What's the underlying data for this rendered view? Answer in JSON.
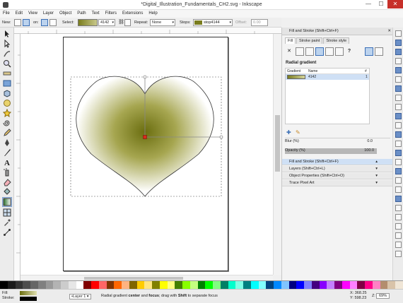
{
  "window": {
    "title": "*Digital_Illustration_Fundamentals_CH2.svg - Inkscape",
    "min": "—",
    "max": "☐",
    "close": "✕"
  },
  "menu": [
    "File",
    "Edit",
    "View",
    "Layer",
    "Object",
    "Path",
    "Text",
    "Filters",
    "Extensions",
    "Help"
  ],
  "toolctrl": {
    "new_label": "New:",
    "on_label": "on:",
    "select_label": "Select:",
    "gradient_name": "4142",
    "repeat_label": "Repeat:",
    "repeat_value": "None",
    "stops_label": "Stops:",
    "stop_value": "stop4144",
    "offset_label": "Offset:",
    "offset_value": "0.00"
  },
  "dock": {
    "header": "Fill and Stroke (Shift+Ctrl+F)",
    "tabs": [
      "Fill",
      "Stroke paint",
      "Stroke style"
    ],
    "paint_buttons": [
      "✕",
      "",
      "",
      "",
      "",
      "",
      "?"
    ],
    "gradient_type": "Radial gradient",
    "table_headers": {
      "gradient": "Gradient",
      "name": "Name",
      "num": "#"
    },
    "gradients": [
      {
        "name": "4142",
        "count": "1"
      }
    ],
    "blur_label": "Blur (%)",
    "blur_value": "0.0",
    "opacity_label": "Opacity (%)",
    "opacity_value": "100.0",
    "items": [
      "Fill and Stroke (Shift+Ctrl+F)",
      "Layers (Shift+Ctrl+L)",
      "Object Properties (Shift+Ctrl+O)",
      "Trace Pixel Art"
    ]
  },
  "status": {
    "fill_label": "Fill:",
    "stroke_label": "Stroke:",
    "layer": "•Layer 1",
    "message_prefix": "Radial gradient",
    "message_b1": "center",
    "message_mid1": "and",
    "message_b2": "focus",
    "message_mid2": "; drag with",
    "message_b3": "Shift",
    "message_suffix": "to separate focus",
    "x_label": "X:",
    "x_value": "368.25",
    "y_label": "Y:",
    "y_value": "598.23",
    "z_label": "Z:",
    "zoom": "69%"
  },
  "colors": {
    "gradient_center": "#6b6e10",
    "gradient_edge": "#ffffff",
    "accent": "#3b6fb6"
  },
  "icons": [
    "selector-icon",
    "node-icon",
    "tweak-icon",
    "zoom-icon",
    "measure-icon",
    "rect-icon",
    "3dbox-icon",
    "ellipse-icon",
    "star-icon",
    "spiral-icon",
    "pencil-icon",
    "pen-icon",
    "calligraphy-icon",
    "text-icon",
    "spray-icon",
    "eraser-icon",
    "bucket-icon",
    "gradient-icon",
    "mesh-icon",
    "dropper-icon",
    "connector-icon"
  ]
}
